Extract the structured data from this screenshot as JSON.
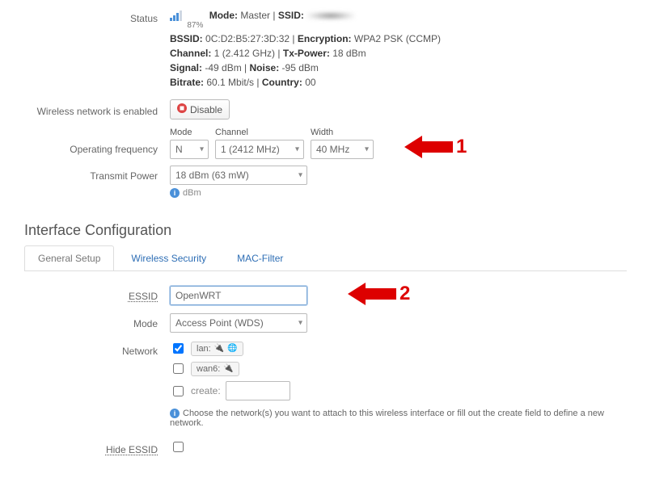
{
  "status": {
    "label": "Status",
    "percent": "87%",
    "mode_k": "Mode:",
    "mode_v": "Master",
    "ssid_k": "SSID:",
    "bssid_k": "BSSID:",
    "bssid_v": "0C:D2:B5:27:3D:32",
    "enc_k": "Encryption:",
    "enc_v": "WPA2 PSK (CCMP)",
    "ch_k": "Channel:",
    "ch_v": "1 (2.412 GHz)",
    "tx_k": "Tx-Power:",
    "tx_v": "18 dBm",
    "sig_k": "Signal:",
    "sig_v": "-49 dBm",
    "noise_k": "Noise:",
    "noise_v": "-95 dBm",
    "bit_k": "Bitrate:",
    "bit_v": "60.1 Mbit/s",
    "cty_k": "Country:",
    "cty_v": "00"
  },
  "enabled_row": {
    "label": "Wireless network is enabled",
    "btn": "Disable"
  },
  "opfreq": {
    "label": "Operating frequency",
    "mode_head": "Mode",
    "mode_val": "N",
    "chan_head": "Channel",
    "chan_val": "1 (2412 MHz)",
    "width_head": "Width",
    "width_val": "40 MHz"
  },
  "txpower": {
    "label": "Transmit Power",
    "value": "18 dBm (63 mW)",
    "hint": "dBm"
  },
  "iface": {
    "heading": "Interface Configuration",
    "tabs": {
      "general": "General Setup",
      "security": "Wireless Security",
      "mac": "MAC-Filter"
    },
    "essid_label": "ESSID",
    "essid_value": "OpenWRT",
    "mode_label": "Mode",
    "mode_value": "Access Point (WDS)",
    "net_label": "Network",
    "net_items": {
      "lan": "lan:",
      "wan6": "wan6:",
      "create": "create:"
    },
    "net_hint": "Choose the network(s) you want to attach to this wireless interface or fill out the create field to define a new network.",
    "hide_label": "Hide ESSID"
  },
  "ann": {
    "one": "1",
    "two": "2"
  }
}
